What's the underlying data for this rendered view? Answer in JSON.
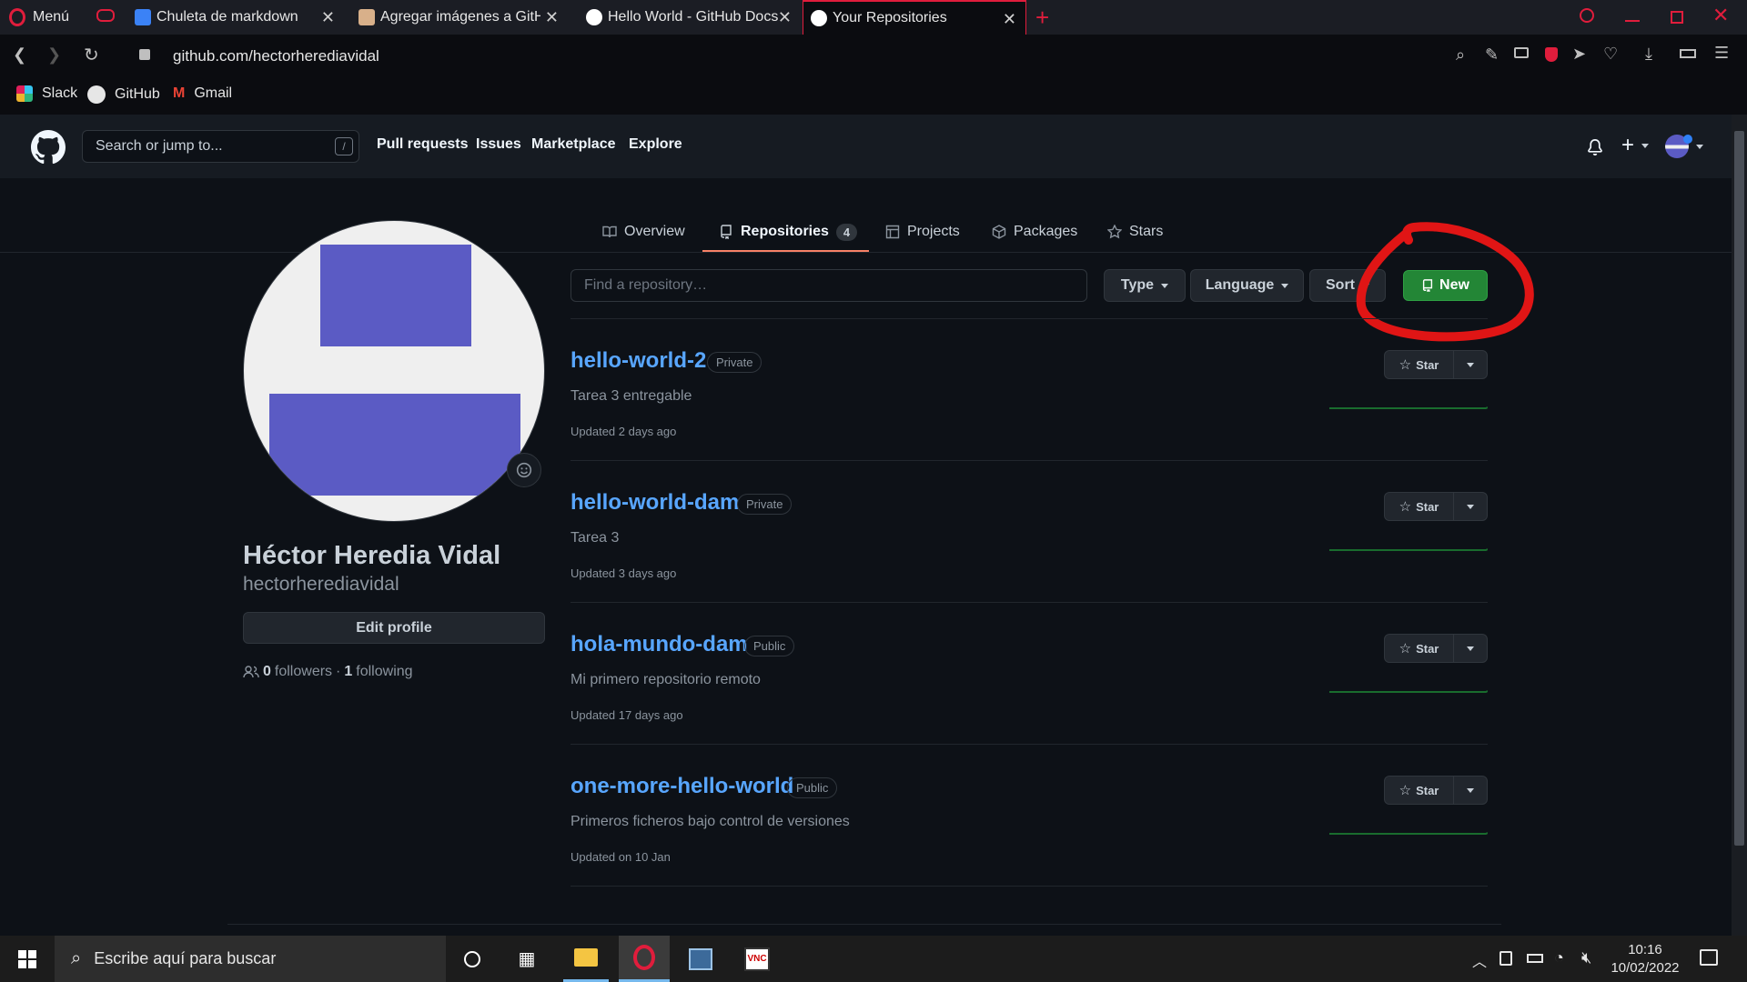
{
  "browser": {
    "menu_label": "Menú",
    "tabs": [
      {
        "title": "Chuleta de markdown"
      },
      {
        "title": "Agregar imágenes a GitHub"
      },
      {
        "title": "Hello World - GitHub Docs"
      },
      {
        "title": "Your Repositories"
      }
    ],
    "url": "github.com/hectorherediavidal",
    "bookmarks": [
      "Slack",
      "GitHub",
      "Gmail"
    ],
    "accent": "#e01d3c"
  },
  "github": {
    "search_placeholder": "Search or jump to...",
    "search_shortcut": "/",
    "nav": [
      "Pull requests",
      "Issues",
      "Marketplace",
      "Explore"
    ],
    "tabs": [
      {
        "label": "Overview",
        "icon": "book-icon"
      },
      {
        "label": "Repositories",
        "icon": "repo-icon",
        "count": "4",
        "selected": true
      },
      {
        "label": "Projects",
        "icon": "project-icon"
      },
      {
        "label": "Packages",
        "icon": "package-icon"
      },
      {
        "label": "Stars",
        "icon": "star-icon"
      }
    ],
    "find_placeholder": "Find a repository…",
    "filters": [
      "Type",
      "Language",
      "Sort"
    ],
    "new_label": "New",
    "profile": {
      "full_name": "Héctor Heredia Vidal",
      "username": "hectorherediavidal",
      "edit_label": "Edit profile",
      "followers_count": "0",
      "followers_label": "followers",
      "separator": "·",
      "following_count": "1",
      "following_label": "following"
    },
    "repos": [
      {
        "name": "hello-world-2",
        "visibility": "Private",
        "description": "Tarea 3 entregable",
        "updated": "Updated 2 days ago",
        "star_label": "Star"
      },
      {
        "name": "hello-world-dam",
        "visibility": "Private",
        "description": "Tarea 3",
        "updated": "Updated 3 days ago",
        "star_label": "Star"
      },
      {
        "name": "hola-mundo-dam",
        "visibility": "Public",
        "description": "Mi primero repositorio remoto",
        "updated": "Updated 17 days ago",
        "star_label": "Star"
      },
      {
        "name": "one-more-hello-world",
        "visibility": "Public",
        "description": "Primeros ficheros bajo control de versiones",
        "updated": "Updated on 10 Jan",
        "star_label": "Star"
      }
    ],
    "colors": {
      "link": "#58a6ff",
      "new_button": "#238636",
      "annotation_circle": "#e01515"
    }
  },
  "taskbar": {
    "search_placeholder": "Escribe aquí para buscar",
    "time": "10:16",
    "date": "10/02/2022"
  }
}
